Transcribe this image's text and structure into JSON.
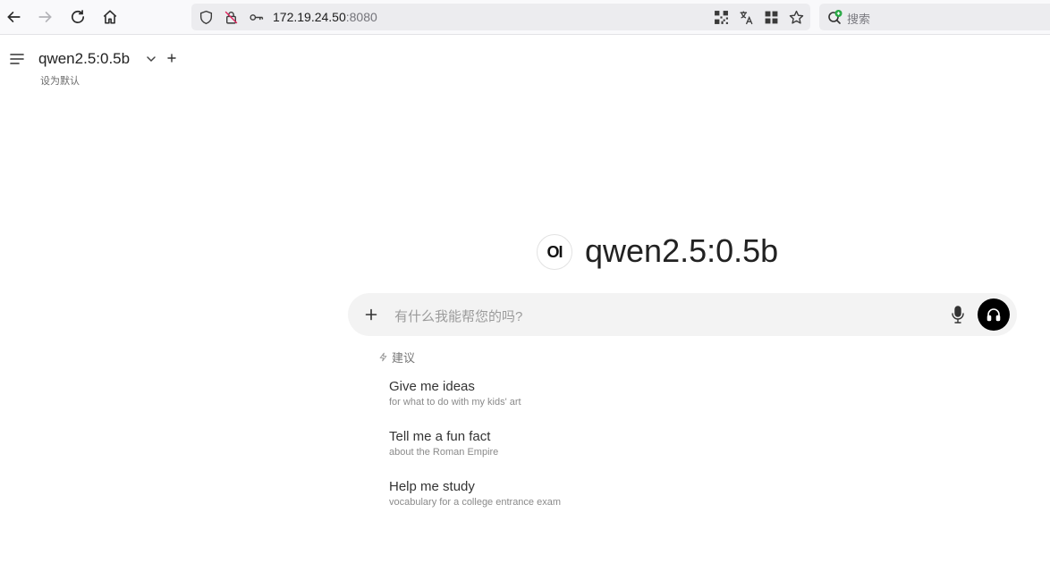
{
  "browser": {
    "url_host": "172.19.24.50",
    "url_port": ":8080",
    "search_placeholder": "搜索"
  },
  "header": {
    "model_name": "qwen2.5:0.5b",
    "set_default": "设为默认"
  },
  "hero": {
    "logo_text": "OI",
    "title": "qwen2.5:0.5b"
  },
  "prompt": {
    "placeholder": "有什么我能帮您的吗?"
  },
  "suggestions": {
    "heading": "建议",
    "items": [
      {
        "title": "Give me ideas",
        "subtitle": "for what to do with my kids' art"
      },
      {
        "title": "Tell me a fun fact",
        "subtitle": "about the Roman Empire"
      },
      {
        "title": "Help me study",
        "subtitle": "vocabulary for a college entrance exam"
      }
    ]
  }
}
